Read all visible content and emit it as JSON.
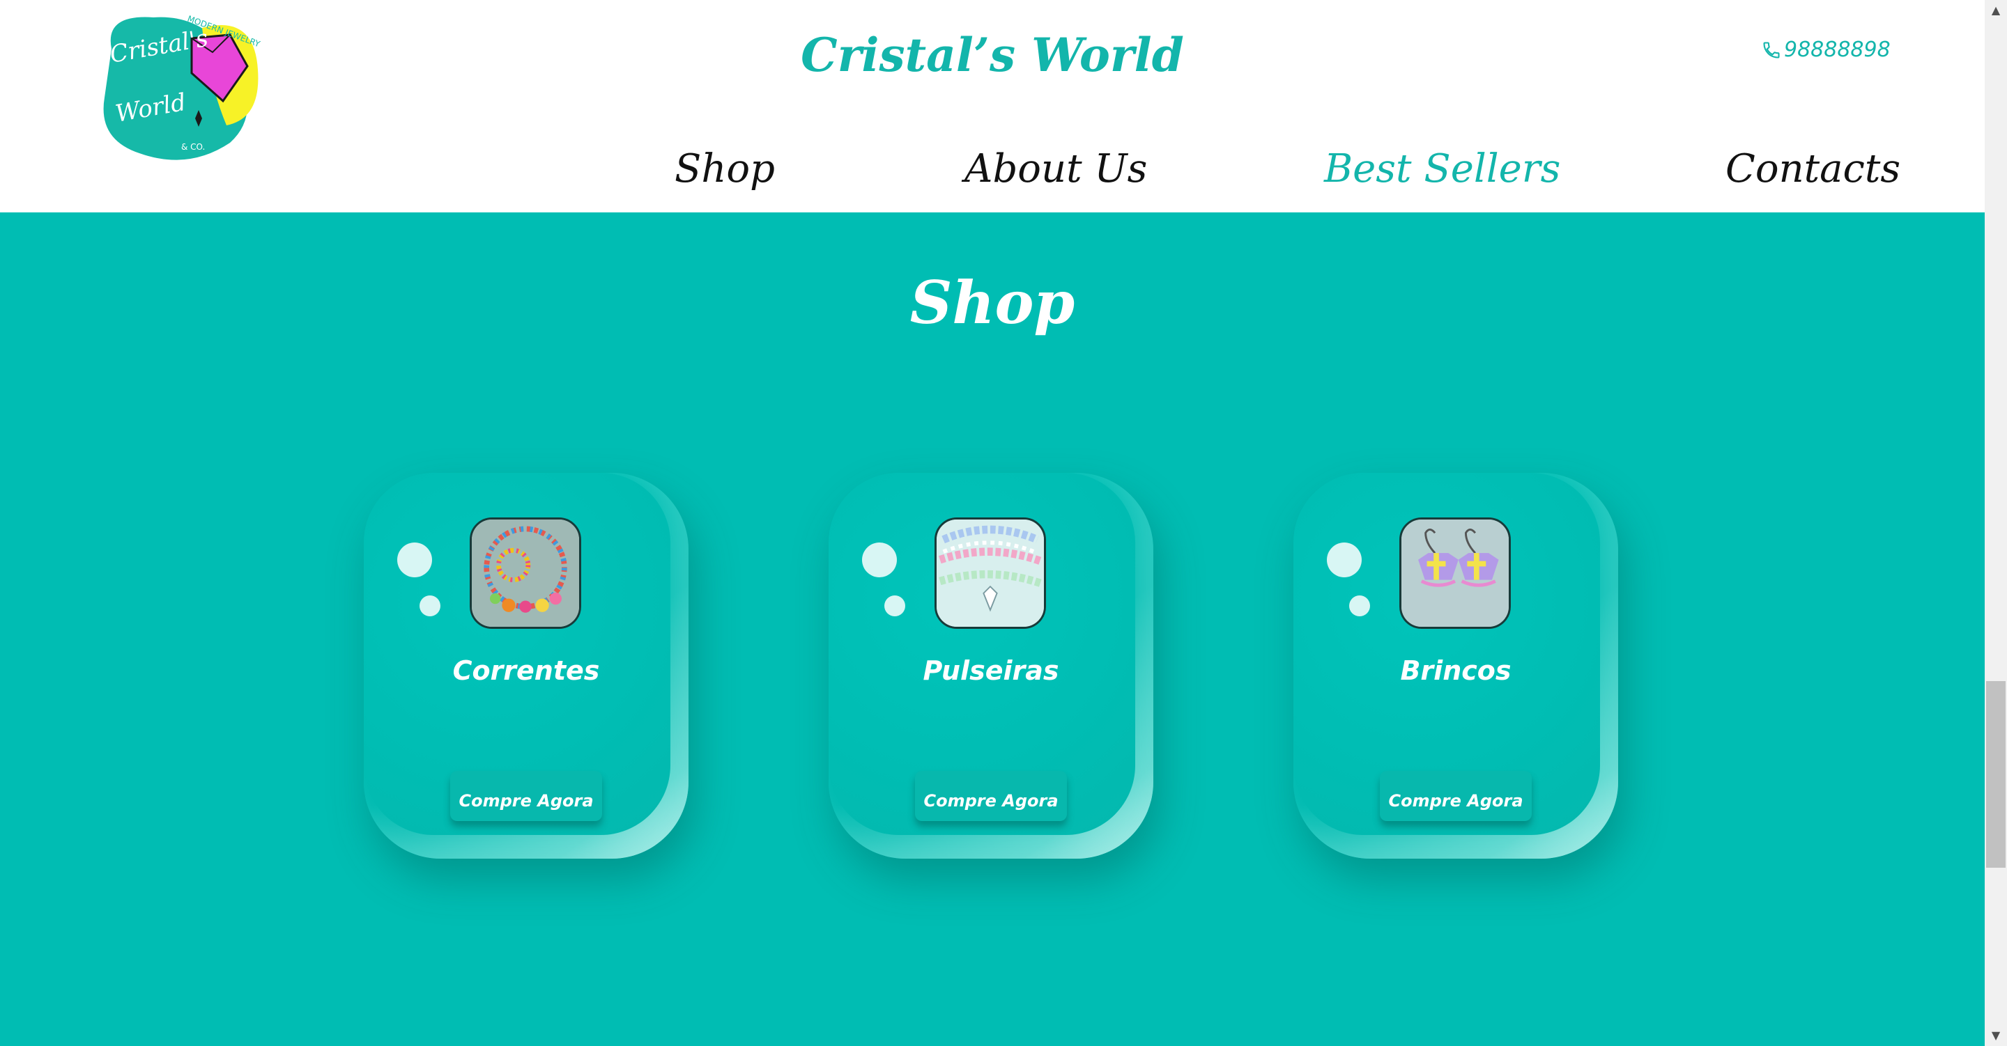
{
  "header": {
    "title": "Cristal’s World",
    "phone": "98888898",
    "nav": [
      {
        "label": "Shop",
        "active": false
      },
      {
        "label": "About Us",
        "active": false
      },
      {
        "label": "Best Sellers",
        "active": true
      },
      {
        "label": "Contacts",
        "active": false
      }
    ]
  },
  "logo": {
    "line1": "Cristal's",
    "line2": "World",
    "line3": "& CO.",
    "arc_text": "MODERN JEWELRY"
  },
  "shop": {
    "heading": "Shop",
    "cards": [
      {
        "title": "Correntes",
        "button": "Compre Agora",
        "image": "necklace-photo"
      },
      {
        "title": "Pulseiras",
        "button": "Compre Agora",
        "image": "bracelet-photo"
      },
      {
        "title": "Brincos",
        "button": "Compre Agora",
        "image": "earrings-photo"
      }
    ]
  },
  "colors": {
    "accent": "#13b5ab",
    "section_bg": "#00bdb3",
    "logo_pink": "#e846d8",
    "logo_yellow": "#f7f227"
  }
}
